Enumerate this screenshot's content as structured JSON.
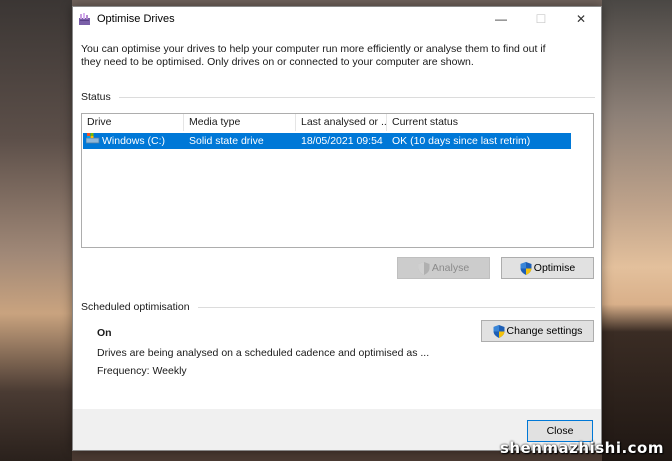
{
  "window": {
    "title": "Optimise Drives",
    "controls": {
      "minimize": "—",
      "maximize": "☐",
      "close": "✕"
    }
  },
  "intro_text": "You can optimise your drives to help your computer run more efficiently or analyse them to find out if they need to be optimised. Only drives on or connected to your computer are shown.",
  "status_section": {
    "label": "Status",
    "columns": [
      "Drive",
      "Media type",
      "Last analysed or ...",
      "Current status"
    ],
    "rows": [
      {
        "drive": "Windows (C:)",
        "media_type": "Solid state drive",
        "last_analysed": "18/05/2021 09:54",
        "current_status": "OK (10 days since last retrim)",
        "selected": true
      }
    ],
    "analyse_label": "Analyse",
    "optimise_label": "Optimise"
  },
  "scheduled_section": {
    "label": "Scheduled optimisation",
    "state": "On",
    "description": "Drives are being analysed on a scheduled cadence and optimised as ...",
    "frequency": "Frequency: Weekly",
    "change_settings_label": "Change settings"
  },
  "footer": {
    "close_label": "Close"
  },
  "watermark": "shenmazhishi.com",
  "colors": {
    "selection": "#0078d7",
    "button_bg": "#e1e1e1",
    "footer_bg": "#f0f0f0"
  }
}
